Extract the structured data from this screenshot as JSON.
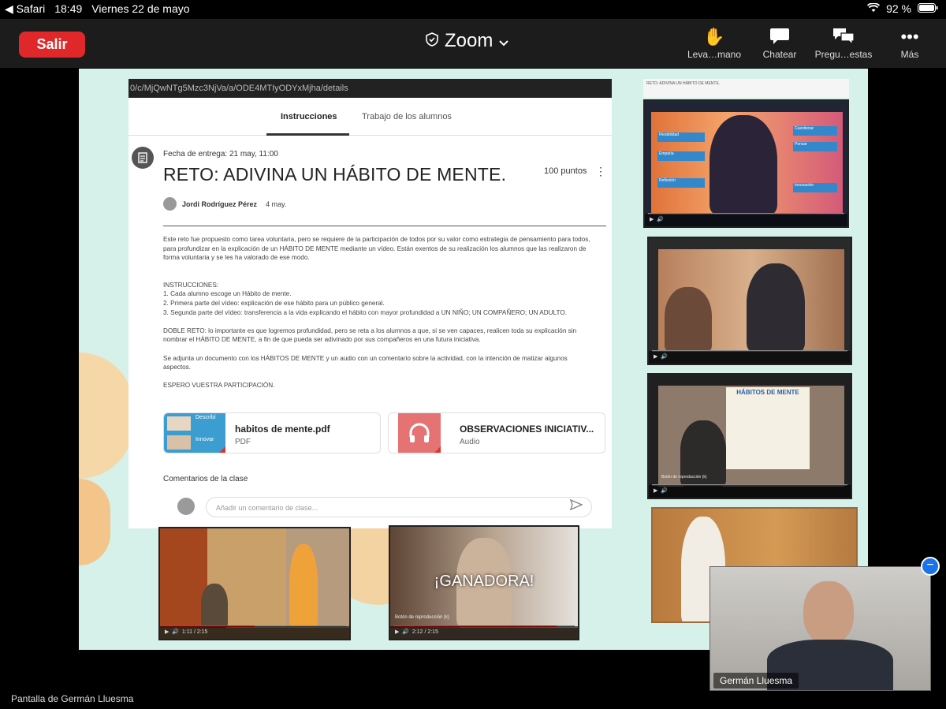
{
  "status_bar": {
    "app": "Safari",
    "time": "18:49",
    "date": "Viernes 22 de mayo",
    "battery": "92 %"
  },
  "zoom": {
    "leave_label": "Salir",
    "title": "Zoom",
    "toolbar": [
      {
        "label": "Leva…mano",
        "icon": "raise-hand-icon"
      },
      {
        "label": "Chatear",
        "icon": "chat-icon"
      },
      {
        "label": "Pregu…estas",
        "icon": "qa-icon"
      },
      {
        "label": "Más",
        "icon": "more-icon"
      }
    ]
  },
  "classroom": {
    "url": "0/c/MjQwNTg5Mzc3NjVa/a/ODE4MTIyODYxMjha/details",
    "tabs": [
      "Instrucciones",
      "Trabajo de los alumnos"
    ],
    "due": "Fecha de entrega: 21 may, 11:00",
    "title": "RETO: ADIVINA UN HÁBITO DE MENTE.",
    "points": "100 puntos",
    "author": "Jordi Rodríguez Pérez",
    "author_date": "4 may.",
    "paragraphs": [
      "Este reto fue propuesto como tarea voluntaria, pero se requiere de la participación de todos por su valor como estrategia de pensamiento para todos, para profundizar en la explicación de un HÁBITO DE MENTE mediante un vídeo. Están exentos de su realización los alumnos que las realizaron de forma voluntaria y se les ha valorado de ese modo.",
      "INSTRUCCIONES:",
      "1. Cada alumno escoge un Hábito de mente.",
      "2. Primera parte del vídeo: explicación de ese hábito para un público general.",
      "3. Segunda parte del vídeo: transferencia a la vida explicando el hábito con mayor profundidad a UN NIÑO; UN COMPAÑERO; UN ADULTO.",
      "DOBLE RETO: lo importante es que logremos profundidad, pero se reta a los alumnos a que, si se ven capaces, realicen toda su explicación sin nombrar el HÁBITO DE MENTE, a fin de que pueda ser adivinado por sus compañeros en una futura iniciativa.",
      "Se adjunta un documento con los HÁBITOS DE MENTE y un audio con un comentario sobre la actividad, con la intención de matizar algunos aspectos.",
      "ESPERO VUESTRA PARTICIPACIÓN."
    ],
    "attachments": [
      {
        "name": "habitos de mente.pdf",
        "type": "PDF",
        "thumb_labels": [
          "Describí",
          "Innovar"
        ]
      },
      {
        "name": "OBSERVACIONES INICIATIV...",
        "type": "Audio"
      }
    ],
    "comments_label": "Comentarios de la clase",
    "comment_placeholder": "Añadir un comentario de clase..."
  },
  "videos": {
    "bottom_left": {
      "time": "1:11 / 2:15",
      "progress": 0.5
    },
    "bottom_right": {
      "overlay": "¡GANADORA!",
      "caption": "Botón de reproducción (k)",
      "time": "2:12 / 2:15",
      "progress": 0.9
    }
  },
  "right_column": {
    "header": "RETO: ADIVINA UN HÁBITO DE MENTE.",
    "video1_tiles": [
      "Flexibilidad",
      "Empatía",
      "Reflexión",
      "Cuestionar",
      "Pensar",
      "Innovación"
    ],
    "video3_title": "HÁBITOS DE MENTE",
    "video3_caption": "Botón de reproducción (k)"
  },
  "self_view": {
    "name": "Germán Lluesma"
  },
  "footer": "Pantalla de Germán Lluesma"
}
